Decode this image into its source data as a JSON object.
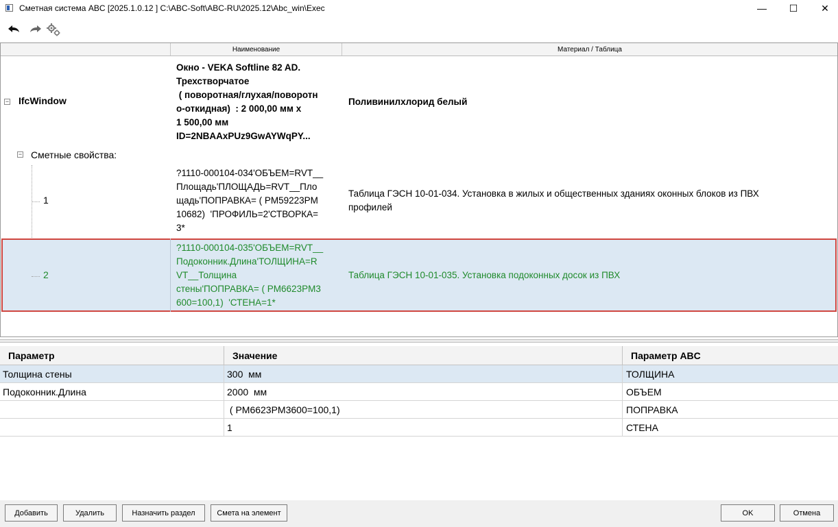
{
  "window": {
    "title": "Сметная система ABC [2025.1.0.12 ]   C:\\ABC-Soft\\ABC-RU\\2025.12\\Abc_win\\Exec",
    "minimize": "—",
    "maximize": "☐",
    "close": "✕"
  },
  "tree": {
    "headers": {
      "name": "Наименование",
      "material": "Материал / Таблица"
    },
    "root": {
      "label": "IfcWindow",
      "name_lines": [
        "Окно - VEKA Softline 82 AD.",
        "Трехстворчатое",
        " ( поворотная/глухая/поворотн",
        "о-откидная)  : 2 000,00 мм x",
        "1 500,00 мм",
        "ID=2NBAAxPUz9GwAYWqPY..."
      ],
      "material": "Поливинилхлорид белый"
    },
    "group": {
      "label": "Сметные свойства:"
    },
    "items": [
      {
        "index": "1",
        "name_lines": [
          "?1110-000104-034'ОБЪЕМ=RVT__",
          "Площадь'ПЛОЩАДЬ=RVT__Пло",
          "щадь'ПОПРАВКА= ( PM59223PM",
          "10682)  'ПРОФИЛЬ=2'СТВОРКА=",
          "3*"
        ],
        "material_lines": [
          "Таблица ГЭСН 10-01-034. Установка в жилых и общественных зданиях оконных блоков из ПВХ",
          "профилей"
        ]
      },
      {
        "index": "2",
        "name_lines": [
          "?1110-000104-035'ОБЪЕМ=RVT__",
          "Подоконник.Длина'ТОЛЩИНА=R",
          "VT__Толщина",
          "стены'ПОПРАВКА= ( PM6623PM3",
          "600=100,1)  'СТЕНА=1*"
        ],
        "material": "Таблица ГЭСН 10-01-035. Установка подоконных досок из ПВХ"
      }
    ]
  },
  "params": {
    "headers": {
      "param": "Параметр",
      "value": "Значение",
      "abc": "Параметр ABC"
    },
    "rows": [
      {
        "param": "Толщина стены",
        "value": "300  мм",
        "abc": "ТОЛЩИНА"
      },
      {
        "param": "Подоконник.Длина",
        "value": "2000  мм",
        "abc": "ОБЪЕМ"
      },
      {
        "param": "",
        "value": " ( PM6623PM3600=100,1)",
        "abc": "ПОПРАВКА"
      },
      {
        "param": "",
        "value": "1",
        "abc": "СТЕНА"
      }
    ]
  },
  "buttons": {
    "add": "Добавить",
    "delete": "Удалить",
    "assign_section": "Назначить раздел",
    "estimate": "Смета на элемент",
    "ok": "OK",
    "cancel": "Отмена"
  }
}
